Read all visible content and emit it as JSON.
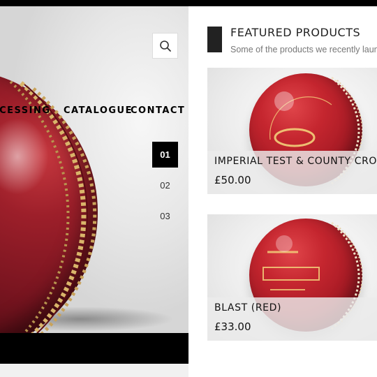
{
  "nav": {
    "items": [
      "PROCESSING",
      "CATALOGUE",
      "CONTACT"
    ]
  },
  "slider": {
    "items": [
      "01",
      "02",
      "03"
    ],
    "active": "01"
  },
  "icons": {
    "search": "search-icon"
  },
  "featured": {
    "title": "FEATURED PRODUCTS",
    "subtitle": "Some of the products we recently launched"
  },
  "products": [
    {
      "name": "IMPERIAL TEST & COUNTY CROWN",
      "price": "£50.00"
    },
    {
      "name": "BLAST (RED)",
      "price": "£33.00"
    }
  ],
  "colors": {
    "accent": "#000000",
    "ball_red": "#a81b25",
    "seam_gold": "#d9b56a"
  }
}
